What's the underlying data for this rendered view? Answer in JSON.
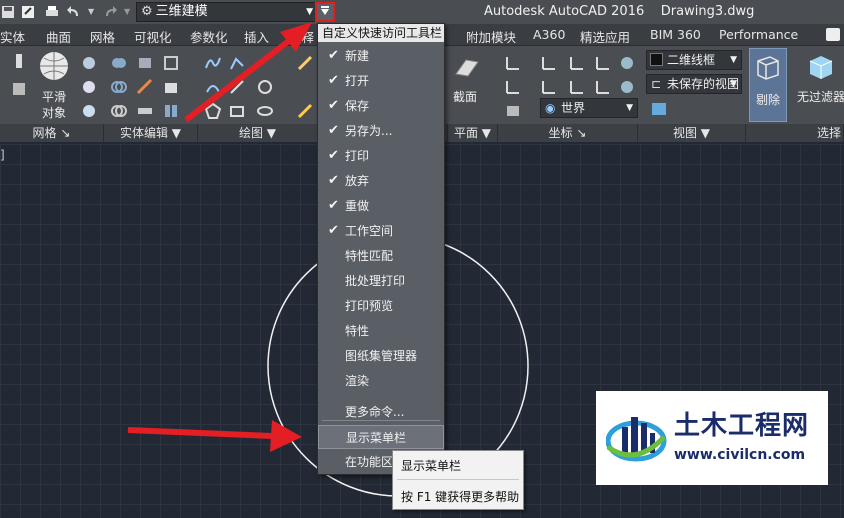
{
  "titlebar": {
    "workspace": "三维建模",
    "app_title": "Autodesk AutoCAD 2016",
    "doc_title": "Drawing3.dwg"
  },
  "tabs": [
    "实体",
    "曲面",
    "网格",
    "可视化",
    "参数化",
    "插入",
    "注释",
    "附加模块",
    "A360",
    "精选应用",
    "BIM 360",
    "Performance"
  ],
  "ribbon": {
    "mesh_button": [
      "平滑",
      "对象"
    ],
    "visual_style": "二维线框",
    "view_combo": "未保存的视图",
    "ucs_combo": "世界",
    "section_button": [
      "截面",
      "平面"
    ],
    "cull_button": "剔除",
    "filter_button": "无过滤器",
    "panels": [
      "网格",
      "实体编辑",
      "绘图",
      "坐标",
      "视图",
      "选择"
    ]
  },
  "qat_menu": {
    "header": "自定义快速访问工具栏",
    "items": [
      {
        "label": "新建",
        "checked": true
      },
      {
        "label": "打开",
        "checked": true
      },
      {
        "label": "保存",
        "checked": true
      },
      {
        "label": "另存为...",
        "checked": true
      },
      {
        "label": "打印",
        "checked": true
      },
      {
        "label": "放弃",
        "checked": true
      },
      {
        "label": "重做",
        "checked": true
      },
      {
        "label": "工作空间",
        "checked": true
      },
      {
        "label": "特性匹配",
        "checked": false
      },
      {
        "label": "批处理打印",
        "checked": false
      },
      {
        "label": "打印预览",
        "checked": false
      },
      {
        "label": "特性",
        "checked": false
      },
      {
        "label": "图纸集管理器",
        "checked": false
      },
      {
        "label": "渲染",
        "checked": false
      }
    ],
    "more_commands": "更多命令...",
    "show_menubar": "显示菜单栏",
    "show_below": "在功能区"
  },
  "tooltip": {
    "title": "显示菜单栏",
    "help": "按 F1 键获得更多帮助"
  },
  "canvas": {
    "bracket": "]"
  },
  "watermark": {
    "title": "土木工程网",
    "url": "www.civilcn.com"
  },
  "colors": {
    "accent_red": "#e02020",
    "canvas_bg": "#222934",
    "ribbon_bg": "#4a4d52",
    "watermark_blue": "#1a2c6a"
  }
}
